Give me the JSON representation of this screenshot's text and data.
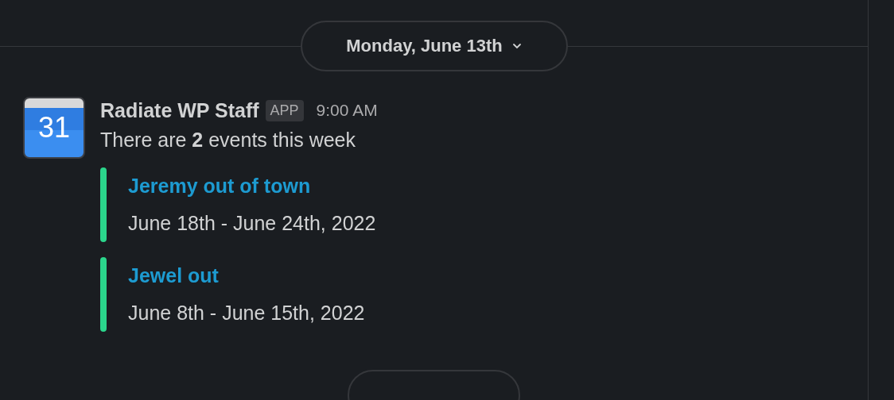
{
  "date_divider": {
    "label": "Monday, June 13th"
  },
  "message": {
    "avatar_text": "31",
    "sender": "Radiate WP Staff",
    "badge": "APP",
    "time": "9:00 AM",
    "text": "There are **2** events this week",
    "attachments": [
      {
        "title": "Jeremy out of town",
        "dates": "June 18th - June 24th, 2022",
        "color": "#2bd68c"
      },
      {
        "title": "Jewel out",
        "dates": "June 8th - June 15th, 2022",
        "color": "#2bd68c"
      }
    ]
  }
}
